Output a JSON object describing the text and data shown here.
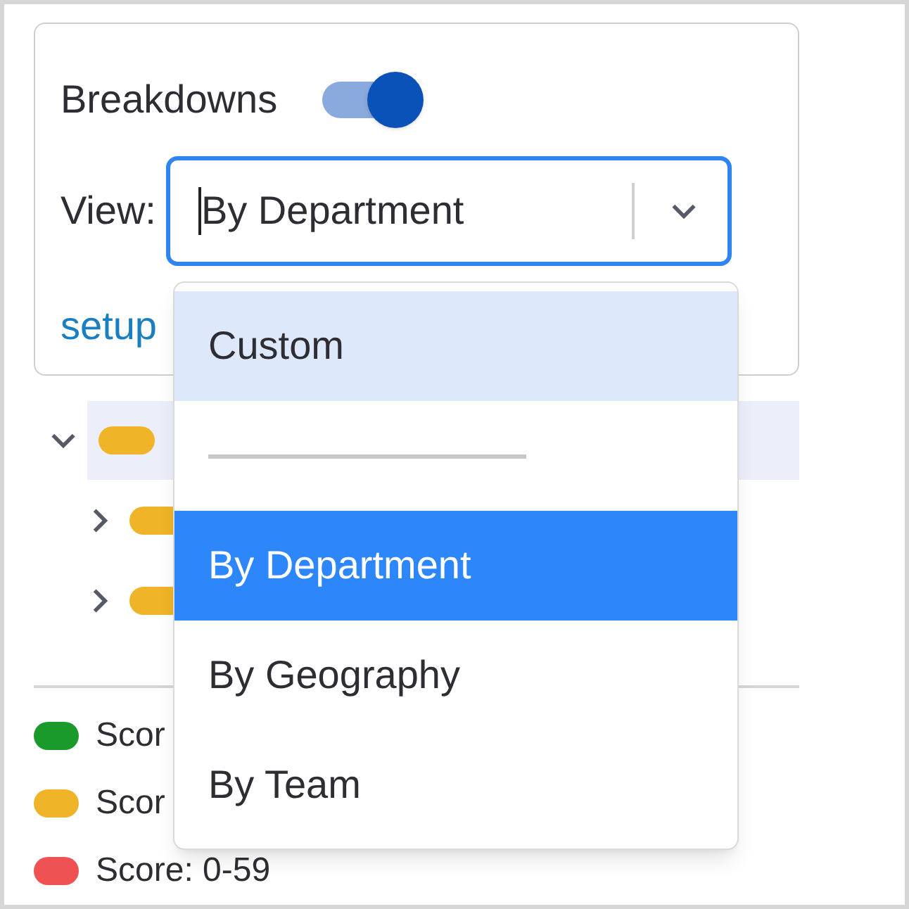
{
  "panel": {
    "toggle": {
      "label": "Breakdowns",
      "on": true
    },
    "view": {
      "label": "View:",
      "value": "By Department"
    },
    "link": "setup"
  },
  "tree": [
    {
      "expanded": true,
      "selected": true,
      "color": "#f0b429",
      "children": [
        {
          "expanded": false,
          "selected": false,
          "color": "#f0b429"
        },
        {
          "expanded": false,
          "selected": false,
          "color": "#f0b429"
        }
      ]
    }
  ],
  "legend": [
    {
      "color": "#1a9a2a",
      "label": "Scor"
    },
    {
      "color": "#f0b429",
      "label": "Scor"
    },
    {
      "color": "#ee5253",
      "label": "Score: 0-59"
    }
  ],
  "menu": {
    "items": [
      {
        "kind": "option",
        "label": "Custom",
        "highlighted": true,
        "selected": false
      },
      {
        "kind": "separator"
      },
      {
        "kind": "option",
        "label": "By Department",
        "highlighted": false,
        "selected": true
      },
      {
        "kind": "option",
        "label": "By Geography",
        "highlighted": false,
        "selected": false
      },
      {
        "kind": "option",
        "label": "By Team",
        "highlighted": false,
        "selected": false
      }
    ]
  }
}
